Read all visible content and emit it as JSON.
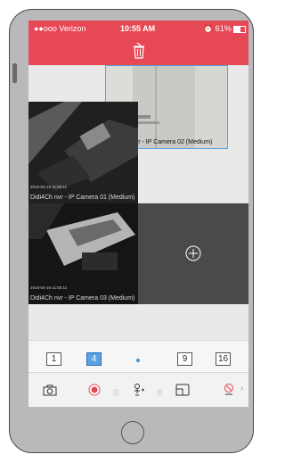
{
  "status_bar": {
    "carrier": "●●ooo Verizon",
    "time": "10:55 AM",
    "battery": "61%"
  },
  "action_bar": {
    "delete_icon": "trash-icon"
  },
  "cameras": [
    {
      "label": "Didi4Ch nvr - IP Camera 02 (Medium)",
      "timestamp": ""
    },
    {
      "label": "Didi4Ch nvr - IP Camera 01 (Medium)",
      "timestamp": "2016-04-16 11:55:11"
    },
    {
      "label": "Didi4Ch nvr - IP Camera 03 (Medium)",
      "timestamp": "2016-04-16 11:55:11"
    }
  ],
  "empty_slot": {
    "icon": "add-camera-icon"
  },
  "layout_options": [
    "1",
    "4",
    "9",
    "16"
  ],
  "active_layout": "4",
  "toolbar": {
    "icons": [
      "snapshot-icon",
      "record-icon",
      "ptz-icon",
      "window-icon",
      "stop-icon"
    ]
  }
}
